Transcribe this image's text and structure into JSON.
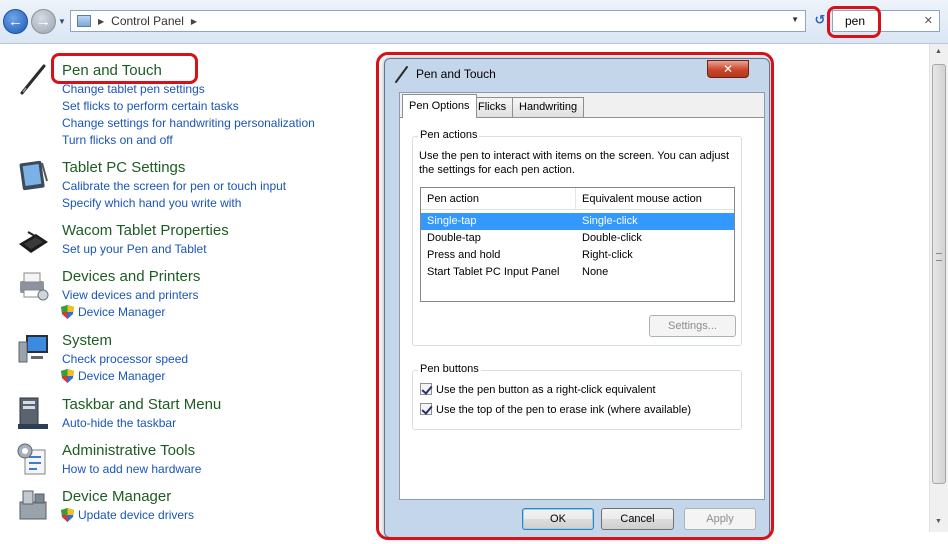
{
  "toolbar": {
    "breadcrumb": "Control Panel",
    "search_value": "pen",
    "clear_glyph": "✕"
  },
  "results": [
    {
      "title": "Pen and Touch",
      "icon": "pen-icon",
      "links": [
        "Change tablet pen settings",
        "Set flicks to perform certain tasks",
        "Change settings for handwriting personalization",
        "Turn flicks on and off"
      ]
    },
    {
      "title": "Tablet PC Settings",
      "icon": "tablet-pc-icon",
      "links": [
        "Calibrate the screen for pen or touch input",
        "Specify which hand you write with"
      ]
    },
    {
      "title": "Wacom Tablet Properties",
      "icon": "wacom-tablet-icon",
      "links": [
        "Set up your Pen and Tablet"
      ]
    },
    {
      "title": "Devices and Printers",
      "icon": "printer-icon",
      "links": [
        "View devices and printers",
        "Device Manager"
      ]
    },
    {
      "title": "System",
      "icon": "computer-icon",
      "links": [
        "Check processor speed",
        "Device Manager"
      ]
    },
    {
      "title": "Taskbar and Start Menu",
      "icon": "taskbar-icon",
      "links": [
        "Auto-hide the taskbar"
      ]
    },
    {
      "title": "Administrative Tools",
      "icon": "admin-tools-icon",
      "links": [
        "How to add new hardware"
      ]
    },
    {
      "title": "Device Manager",
      "icon": "device-manager-icon",
      "links": [
        "Update device drivers"
      ]
    }
  ],
  "dialog": {
    "title": "Pen and Touch",
    "close_glyph": "✕",
    "tabs": [
      "Pen Options",
      "Flicks",
      "Handwriting"
    ],
    "active_tab": "Pen Options",
    "pen_actions": {
      "label": "Pen actions",
      "description": "Use the pen to interact with items on the screen.  You can adjust the settings for each pen action.",
      "columns": [
        "Pen action",
        "Equivalent mouse action"
      ],
      "rows": [
        [
          "Single-tap",
          "Single-click"
        ],
        [
          "Double-tap",
          "Double-click"
        ],
        [
          "Press and hold",
          "Right-click"
        ],
        [
          "Start Tablet PC Input Panel",
          "None"
        ]
      ],
      "selected_row": 0,
      "settings_button": "Settings..."
    },
    "pen_buttons": {
      "label": "Pen buttons",
      "options": [
        {
          "label": "Use the pen button as a right-click equivalent",
          "checked": true
        },
        {
          "label": "Use the top of the pen to erase ink (where available)",
          "checked": true
        }
      ]
    },
    "buttons": {
      "ok": "OK",
      "cancel": "Cancel",
      "apply": "Apply"
    }
  },
  "colors": {
    "highlight": "#d6111a",
    "title_green": "#1e5c23",
    "link_blue": "#1a55b8",
    "selection_blue": "#3399ff"
  }
}
